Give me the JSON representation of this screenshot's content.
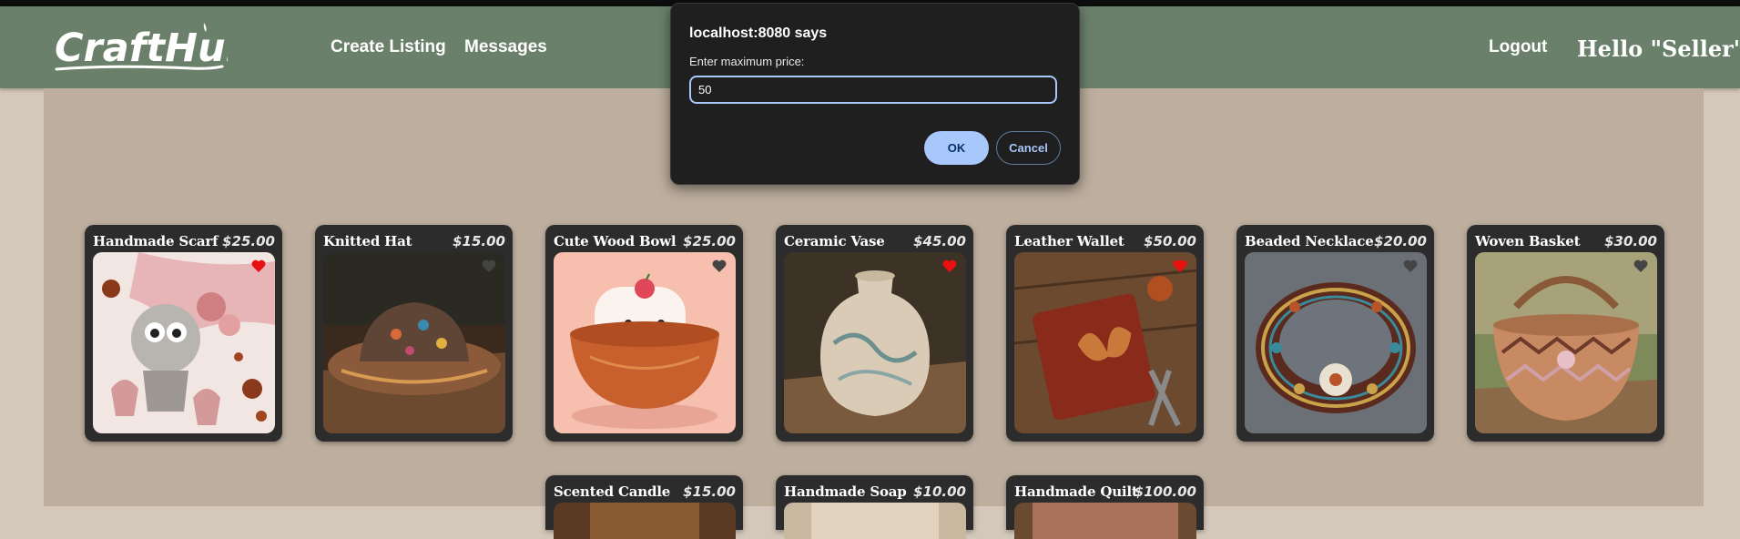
{
  "header": {
    "logo_text": "CraftHub",
    "nav": [
      "Create Listing",
      "Messages"
    ],
    "logout_label": "Logout",
    "greeting": "Hello \"Seller\"!"
  },
  "dialog": {
    "title": "localhost:8080 says",
    "message": "Enter maximum price:",
    "input_value": "50",
    "ok_label": "OK",
    "cancel_label": "Cancel"
  },
  "products": [
    {
      "title": "Handmade Scarf",
      "price": "$25.00",
      "favorited": true
    },
    {
      "title": "Knitted Hat",
      "price": "$15.00",
      "favorited": false
    },
    {
      "title": "Cute Wood Bowl",
      "price": "$25.00",
      "favorited": false
    },
    {
      "title": "Ceramic Vase",
      "price": "$45.00",
      "favorited": true
    },
    {
      "title": "Leather Wallet",
      "price": "$50.00",
      "favorited": true
    },
    {
      "title": "Beaded Necklace",
      "price": "$20.00",
      "favorited": false
    },
    {
      "title": "Woven Basket",
      "price": "$30.00",
      "favorited": false
    },
    {
      "title": "Scented Candle",
      "price": "$15.00"
    },
    {
      "title": "Handmade Soap",
      "price": "$10.00"
    },
    {
      "title": "Handmade Quilt",
      "price": "$100.00"
    }
  ],
  "colors": {
    "header_bg": "#6b806b",
    "content_bg": "#bdae9e",
    "card_bg": "#2c2c2c",
    "heart_active": "#e81010",
    "heart_inactive": "#444444",
    "dialog_accent": "#a8c7fa"
  }
}
